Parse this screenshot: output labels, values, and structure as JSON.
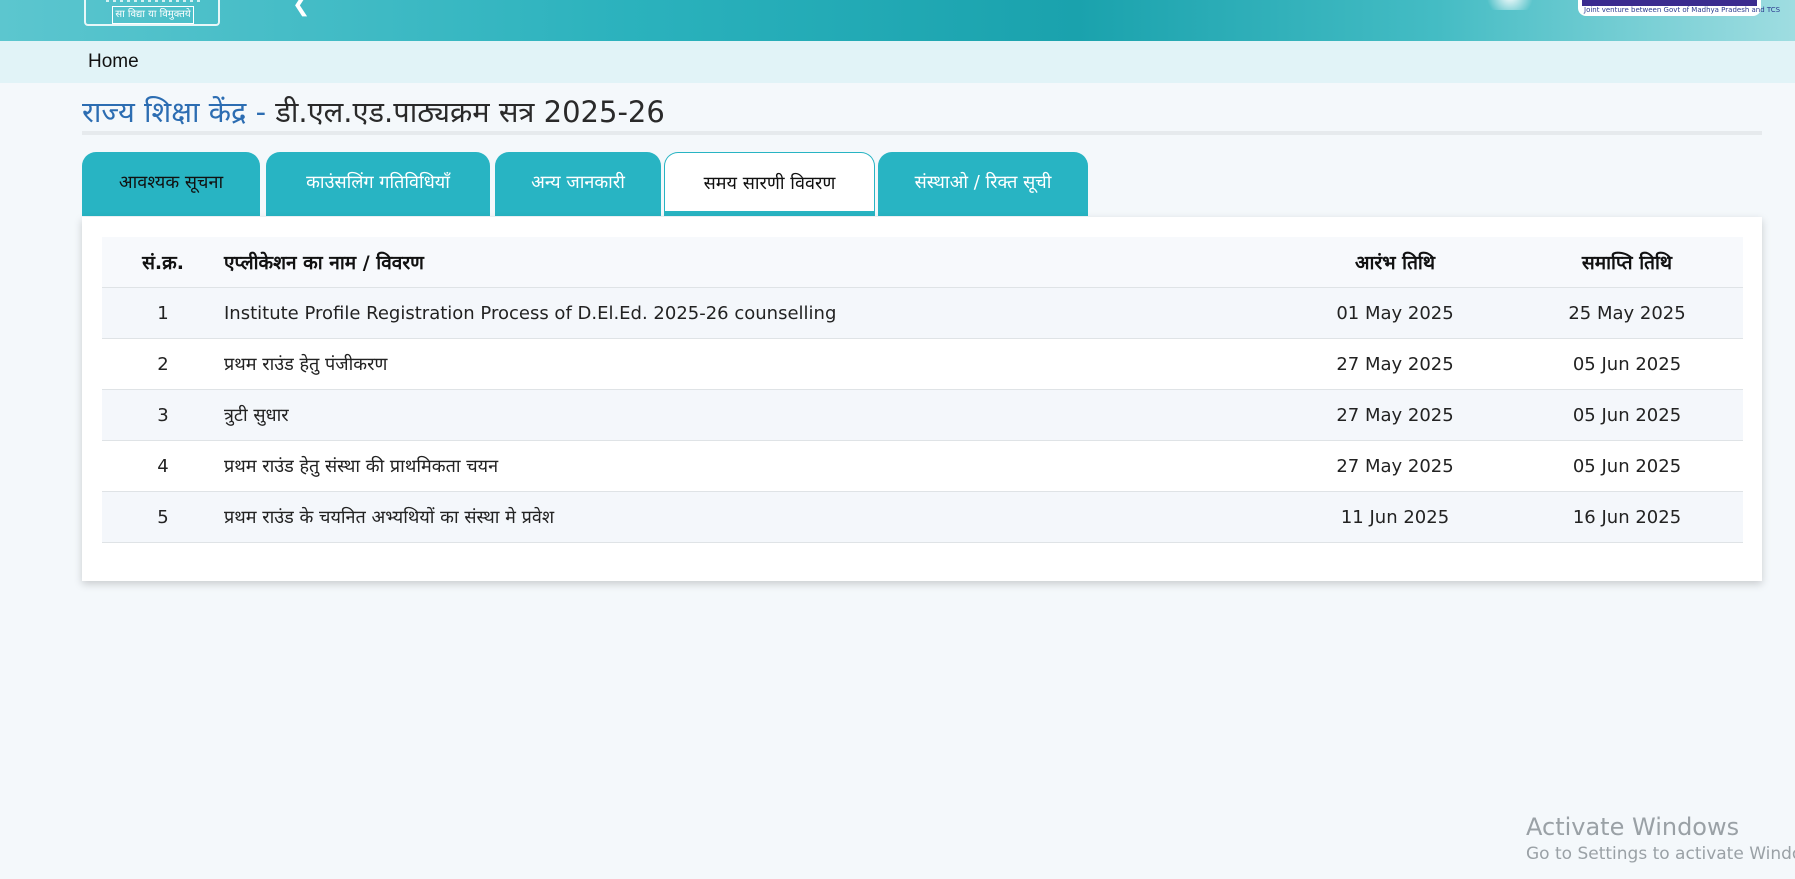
{
  "header": {
    "motto": "सा विद्या या विमुक्तये",
    "partner_tagline": "Joint venture between Govt of Madhya Pradesh and TCS",
    "accent_color": "#28b4c3"
  },
  "breadcrumb": {
    "home": "Home"
  },
  "title": {
    "org": "राज्य शिक्षा केंद्र - ",
    "course": "डी.एल.एड.पाठ्यक्रम सत्र 2025-26"
  },
  "tabs": [
    {
      "label": "आवश्यक सूचना",
      "active": false
    },
    {
      "label": "काउंसलिंग गतिविधियाँ",
      "active": false
    },
    {
      "label": "अन्य जानकारी",
      "active": false
    },
    {
      "label": "समय सारणी विवरण",
      "active": true
    },
    {
      "label": "संस्थाओ / रिक्त सूची",
      "active": false
    }
  ],
  "schedule": {
    "headers": {
      "num": "सं.क्र.",
      "name": "एप्लीकेशन का नाम / विवरण",
      "start": "आरंभ तिथि",
      "end": "समाप्ति तिथि"
    },
    "rows": [
      {
        "num": "1",
        "name": "Institute Profile Registration Process of D.El.Ed. 2025-26 counselling",
        "start": "01 May 2025",
        "end": "25 May 2025"
      },
      {
        "num": "2",
        "name": "प्रथम राउंड हेतु पंजीकरण",
        "start": "27 May 2025",
        "end": "05 Jun 2025"
      },
      {
        "num": "3",
        "name": "त्रुटी सुधार",
        "start": "27 May 2025",
        "end": "05 Jun 2025"
      },
      {
        "num": "4",
        "name": "प्रथम राउंड हेतु संस्था की प्राथमिकता चयन",
        "start": "27 May 2025",
        "end": "05 Jun 2025"
      },
      {
        "num": "5",
        "name": "प्रथम राउंड के चयनित अभ्यथियों का संस्था मे प्रवेश",
        "start": "11 Jun 2025",
        "end": "16 Jun 2025"
      }
    ]
  },
  "watermark": {
    "line1": "Activate Windows",
    "line2": "Go to Settings to activate Windows."
  }
}
